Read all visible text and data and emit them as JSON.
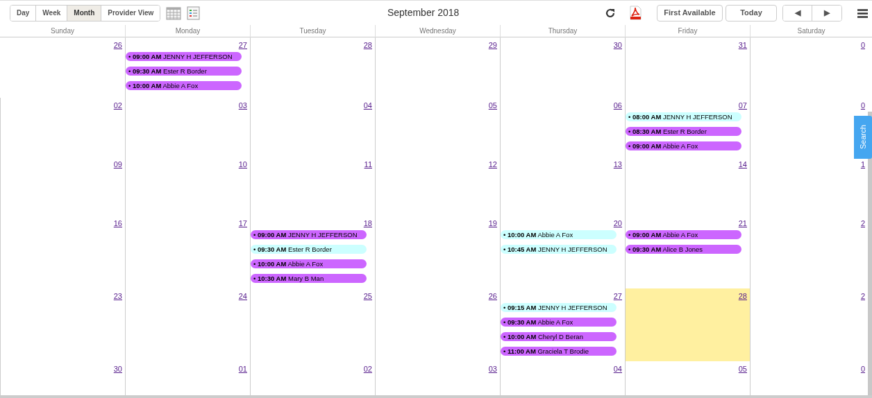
{
  "toolbar": {
    "views": [
      {
        "label": "Day",
        "selected": false
      },
      {
        "label": "Week",
        "selected": false
      },
      {
        "label": "Month",
        "selected": true
      },
      {
        "label": "Provider View",
        "selected": false
      }
    ],
    "title": "September 2018",
    "buttons": [
      "First Available",
      "Today"
    ],
    "nav": [
      "◀",
      "▶"
    ]
  },
  "weekdays": [
    "Sunday",
    "Monday",
    "Tuesday",
    "Wednesday",
    "Thursday",
    "Friday",
    "Saturday"
  ],
  "weeks": [
    [
      {
        "date": "26",
        "today": false
      },
      {
        "date": "27",
        "today": false,
        "events": [
          {
            "bullet": "•",
            "time": "09:00 AM",
            "name": "JENNY H JEFFERSON",
            "color": "#cc66ff"
          },
          {
            "bullet": "•",
            "time": "09:30 AM",
            "name": "Ester R Border",
            "color": "#cc66ff"
          },
          {
            "bullet": "•",
            "time": "10:00 AM",
            "name": "Abbie A Fox",
            "color": "#cc66ff"
          }
        ]
      },
      {
        "date": "28",
        "today": false
      },
      {
        "date": "29",
        "today": false
      },
      {
        "date": "30",
        "today": false
      },
      {
        "date": "31",
        "today": false
      },
      {
        "date": "0",
        "today": false
      }
    ],
    [
      {
        "date": "02",
        "today": false
      },
      {
        "date": "03",
        "today": false
      },
      {
        "date": "04",
        "today": false
      },
      {
        "date": "05",
        "today": false
      },
      {
        "date": "06",
        "today": false
      },
      {
        "date": "07",
        "today": false,
        "events": [
          {
            "bullet": "•",
            "time": "08:00 AM",
            "name": "JENNY H JEFFERSON",
            "color": "#ccffff"
          },
          {
            "bullet": "•",
            "time": "08:30 AM",
            "name": "Ester R Border",
            "color": "#cc66ff"
          },
          {
            "bullet": "•",
            "time": "09:00 AM",
            "name": "Abbie A Fox",
            "color": "#cc66ff"
          }
        ]
      },
      {
        "date": "0",
        "today": false
      }
    ],
    [
      {
        "date": "09",
        "today": false
      },
      {
        "date": "10",
        "today": false
      },
      {
        "date": "11",
        "today": false
      },
      {
        "date": "12",
        "today": false
      },
      {
        "date": "13",
        "today": false
      },
      {
        "date": "14",
        "today": false
      },
      {
        "date": "1",
        "today": false
      }
    ],
    [
      {
        "date": "16",
        "today": false
      },
      {
        "date": "17",
        "today": false
      },
      {
        "date": "18",
        "today": false,
        "events": [
          {
            "bullet": "•",
            "time": "09:00 AM",
            "name": "JENNY H JEFFERSON",
            "color": "#cc66ff"
          },
          {
            "bullet": "•",
            "time": "09:30 AM",
            "name": "Ester R Border",
            "color": "#ccffff"
          },
          {
            "bullet": "•",
            "time": "10:00 AM",
            "name": "Abbie A Fox",
            "color": "#cc66ff"
          },
          {
            "bullet": "•",
            "time": "10:30 AM",
            "name": "Mary B Man",
            "color": "#cc66ff"
          }
        ]
      },
      {
        "date": "19",
        "today": false
      },
      {
        "date": "20",
        "today": false,
        "events": [
          {
            "bullet": "•",
            "time": "10:00 AM",
            "name": "Abbie A Fox",
            "color": "#ccffff"
          },
          {
            "bullet": "•",
            "time": "10:45 AM",
            "name": "JENNY H JEFFERSON",
            "color": "#ccffff"
          }
        ]
      },
      {
        "date": "21",
        "today": false,
        "events": [
          {
            "bullet": "•",
            "time": "09:00 AM",
            "name": "Abbie A Fox",
            "color": "#cc66ff"
          },
          {
            "bullet": "•",
            "time": "09:30 AM",
            "name": "Alice B Jones",
            "color": "#cc66ff"
          }
        ]
      },
      {
        "date": "2",
        "today": false
      }
    ],
    [
      {
        "date": "23",
        "today": false
      },
      {
        "date": "24",
        "today": false
      },
      {
        "date": "25",
        "today": false
      },
      {
        "date": "26",
        "today": false
      },
      {
        "date": "27",
        "today": false,
        "events": [
          {
            "bullet": "•",
            "time": "09:15 AM",
            "name": "JENNY H JEFFERSON",
            "color": "#ccffff"
          },
          {
            "bullet": "•",
            "time": "09:30 AM",
            "name": "Abbie A Fox",
            "color": "#cc66ff"
          },
          {
            "bullet": "•",
            "time": "10:00 AM",
            "name": "Cheryl D Beran",
            "color": "#cc66ff"
          },
          {
            "bullet": "•",
            "time": "11:00 AM",
            "name": "Graciela T Brodie",
            "color": "#cc66ff"
          }
        ]
      },
      {
        "date": "28",
        "today": true
      },
      {
        "date": "2",
        "today": false
      }
    ],
    [
      {
        "date": "30",
        "today": false
      },
      {
        "date": "01",
        "today": false
      },
      {
        "date": "02",
        "today": false
      },
      {
        "date": "03",
        "today": false
      },
      {
        "date": "04",
        "today": false
      },
      {
        "date": "05",
        "today": false
      },
      {
        "date": "0",
        "today": false
      }
    ]
  ],
  "search_tab": "Search"
}
